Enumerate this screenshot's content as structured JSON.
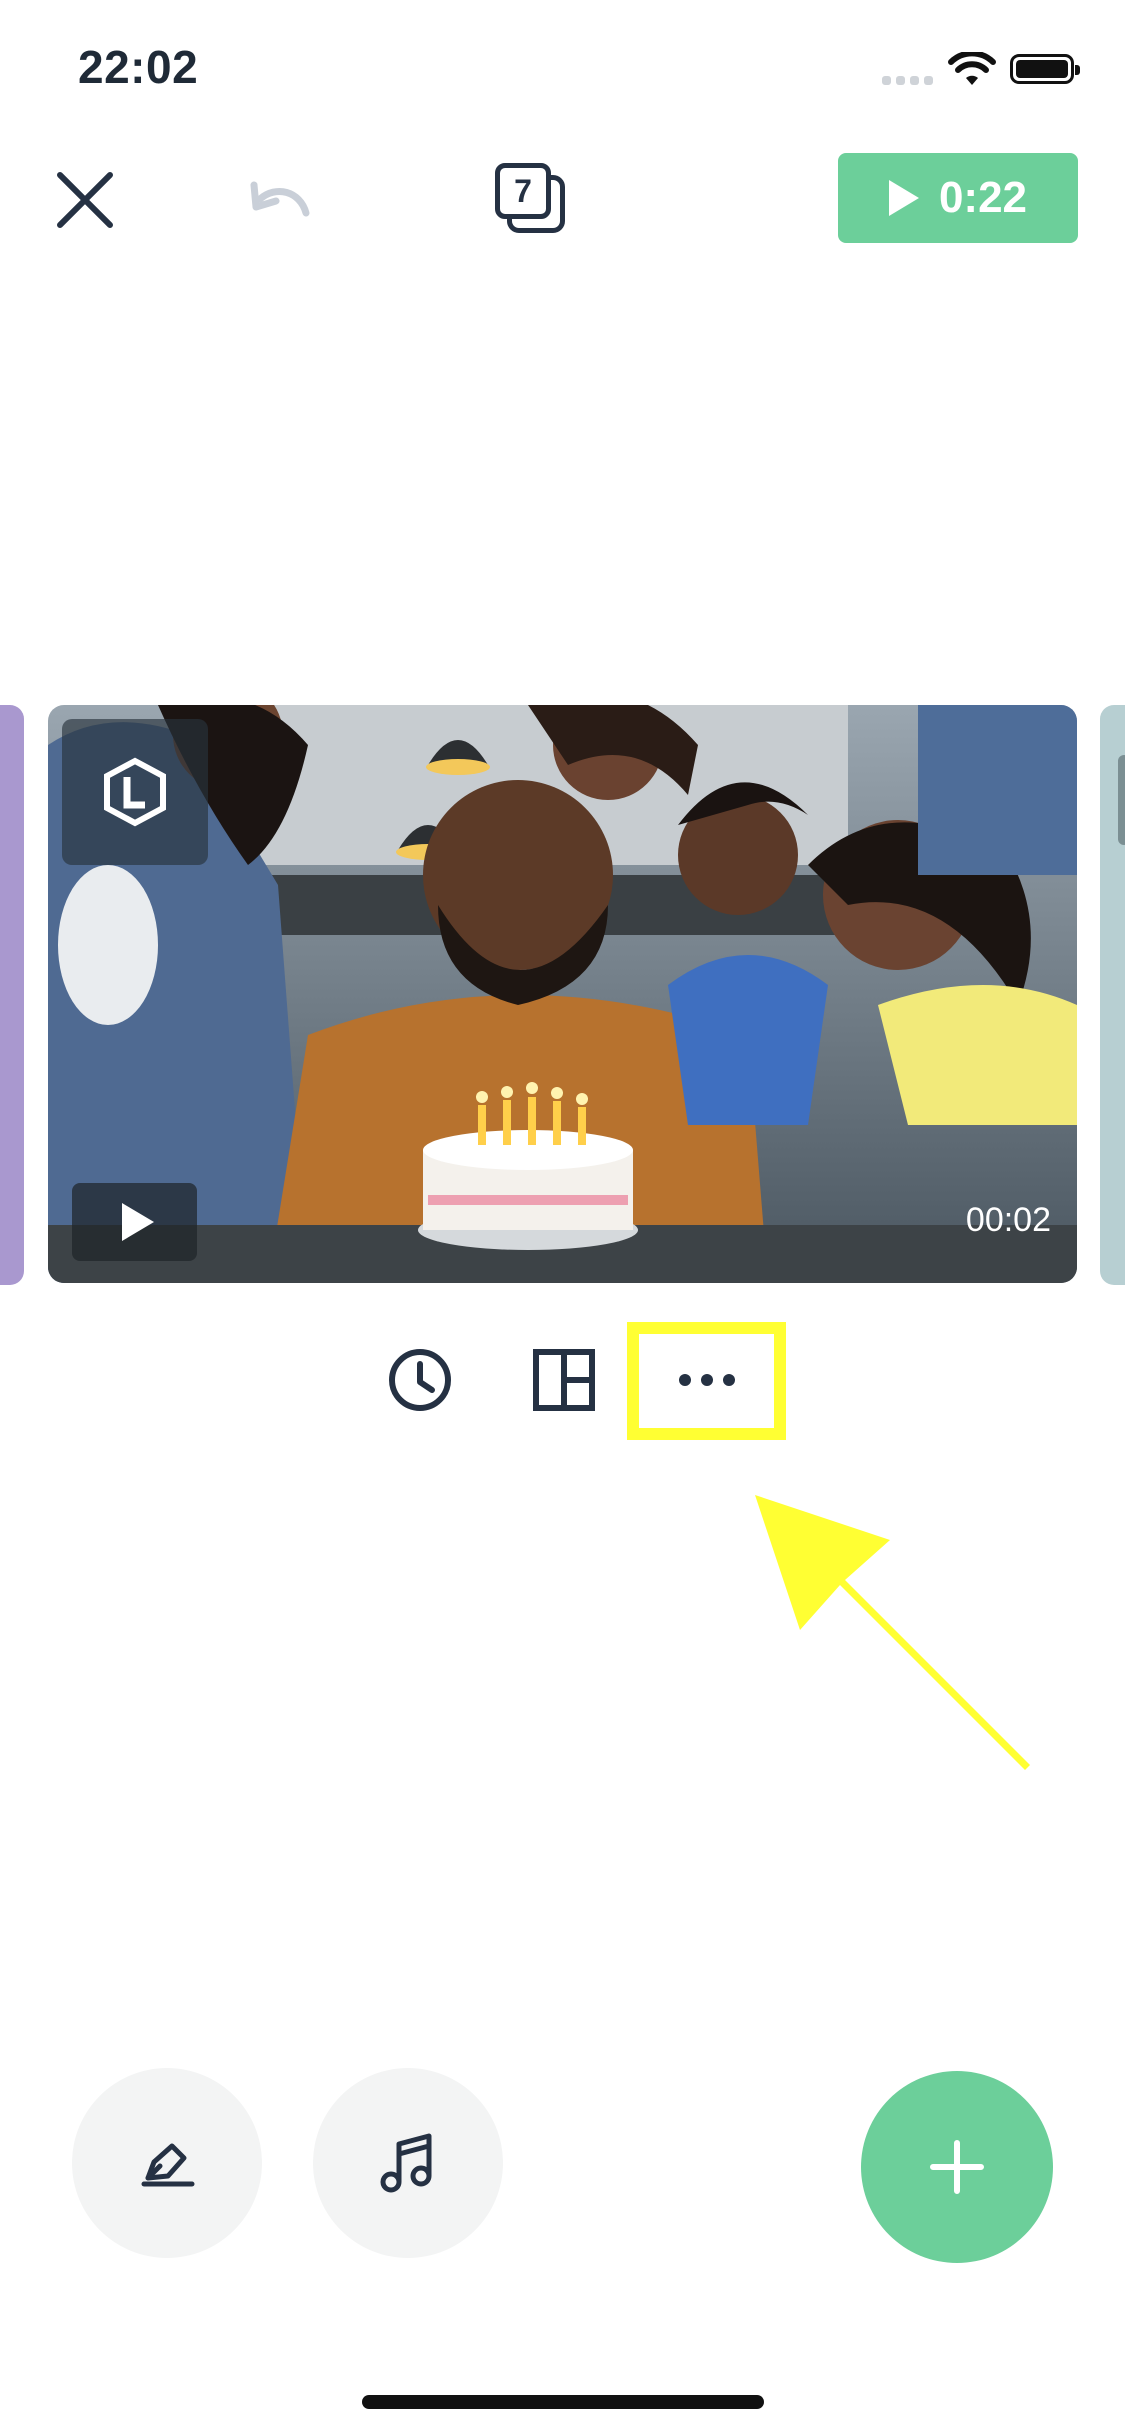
{
  "status_bar": {
    "time": "22:02"
  },
  "toolbar": {
    "clip_count": "7",
    "play_duration": "0:22"
  },
  "clip": {
    "duration": "00:02"
  },
  "colors": {
    "accent": "#6ccf9a",
    "highlight": "#ffff33",
    "ink": "#253143"
  },
  "icons": {
    "close": "close-icon",
    "undo": "undo-icon",
    "clips": "clips-count-icon",
    "play": "play-icon",
    "clock": "clock-icon",
    "layout": "layout-icon",
    "more": "more-icon",
    "pen": "pen-icon",
    "music": "music-note-icon",
    "add": "plus-icon"
  }
}
